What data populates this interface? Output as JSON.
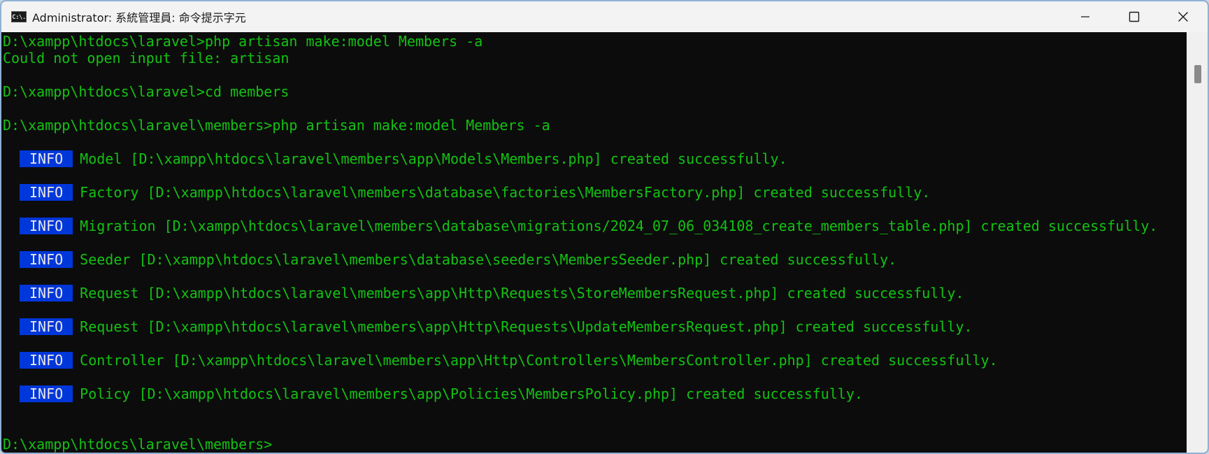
{
  "window": {
    "title": "Administrator: 系統管理員: 命令提示字元",
    "icon_label": "C:\\.",
    "controls": [
      "minimize-icon",
      "maximize-icon",
      "close-icon"
    ]
  },
  "console": {
    "lines": [
      "D:\\xampp\\htdocs\\laravel>php artisan make:model Members -a",
      "Could not open input file: artisan",
      "D:\\xampp\\htdocs\\laravel>cd members",
      "D:\\xampp\\htdocs\\laravel\\members>php artisan make:model Members -a"
    ],
    "info_badge": "INFO",
    "info_messages": [
      "Model [D:\\xampp\\htdocs\\laravel\\members\\app\\Models\\Members.php] created successfully.",
      "Factory [D:\\xampp\\htdocs\\laravel\\members\\database\\factories\\MembersFactory.php] created successfully.",
      "Migration [D:\\xampp\\htdocs\\laravel\\members\\database\\migrations/2024_07_06_034108_create_members_table.php] created successfully.",
      "Seeder [D:\\xampp\\htdocs\\laravel\\members\\database\\seeders\\MembersSeeder.php] created successfully.",
      "Request [D:\\xampp\\htdocs\\laravel\\members\\app\\Http\\Requests\\StoreMembersRequest.php] created successfully.",
      "Request [D:\\xampp\\htdocs\\laravel\\members\\app\\Http\\Requests\\UpdateMembersRequest.php] created successfully.",
      "Controller [D:\\xampp\\htdocs\\laravel\\members\\app\\Http\\Controllers\\MembersController.php] created successfully.",
      "Policy [D:\\xampp\\htdocs\\laravel\\members\\app\\Policies\\MembersPolicy.php] created successfully."
    ],
    "prompt": "D:\\xampp\\htdocs\\laravel\\members>"
  },
  "colors": {
    "console_bg": "#0c0c0c",
    "console_text": "#13c213",
    "badge_bg": "#0037da",
    "badge_text": "#e8e8e8",
    "titlebar_bg": "#f3f3f3"
  }
}
